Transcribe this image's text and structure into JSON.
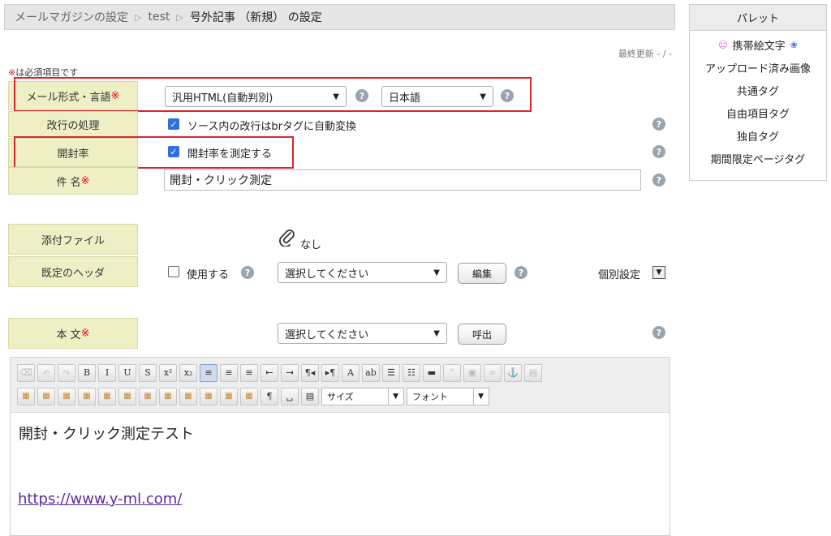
{
  "breadcrumb": {
    "item1": "メールマガジンの設定",
    "item2": "test",
    "current": "号外記事 （新規） の設定",
    "separator": "▷"
  },
  "last_update": "最終更新 - / -",
  "required_note": {
    "mark": "※",
    "text": "は必須項目です"
  },
  "required_mark": "※",
  "help_glyph": "?",
  "check_glyph": "✓",
  "rows": {
    "mail_format": {
      "label": "メール形式・言語",
      "format_value": "汎用HTML(自動判別)",
      "language_value": "日本語"
    },
    "line_break": {
      "label": "改行の処理",
      "checkbox_label": "ソース内の改行はbrタグに自動変換",
      "checked": true
    },
    "open_rate": {
      "label": "開封率",
      "checkbox_label": "開封率を測定する",
      "checked": true
    },
    "subject": {
      "label": "件 名",
      "value": "開封・クリック測定"
    },
    "attachment": {
      "label": "添付ファイル",
      "value": "なし"
    },
    "header": {
      "label": "既定のヘッダ",
      "checkbox_label": "使用する",
      "checked": false,
      "select_value": "選択してください",
      "edit_button": "編集",
      "individual_label": "個別設定"
    },
    "body": {
      "label": "本 文",
      "select_value": "選択してください",
      "call_button": "呼出"
    }
  },
  "palette": {
    "title": "パレット",
    "items": [
      "携帯絵文字",
      "アップロード済み画像",
      "共通タグ",
      "自由項目タグ",
      "独自タグ",
      "期間限定ページタグ"
    ]
  },
  "editor": {
    "toolbar": {
      "row1": [
        "⌫",
        "↶",
        "↷",
        "B",
        "I",
        "U",
        "S",
        "x²",
        "x₂",
        "≡",
        "≡",
        "≡",
        "⇤",
        "⇥",
        "¶◂",
        "▸¶",
        "A",
        "ab",
        "☰",
        "☷",
        "▬",
        "“",
        "▣",
        "∞",
        "⚓",
        "▤"
      ],
      "row2": [
        "▦",
        "▦",
        "▦",
        "▦",
        "▦",
        "▦",
        "▦",
        "▦",
        "▦",
        "▦",
        "▦",
        "▦",
        "¶",
        "␣",
        "▤"
      ],
      "size_label": "サイズ",
      "font_label": "フォント"
    },
    "content_line1": "開封・クリック測定テスト",
    "content_link": "https://www.y-ml.com/"
  },
  "colors": {
    "label_bg": "#efefc6",
    "required": "#e60012",
    "highlight_box": "#d9262d",
    "checkbox": "#2f6fe0",
    "link": "#5b2ca0"
  }
}
